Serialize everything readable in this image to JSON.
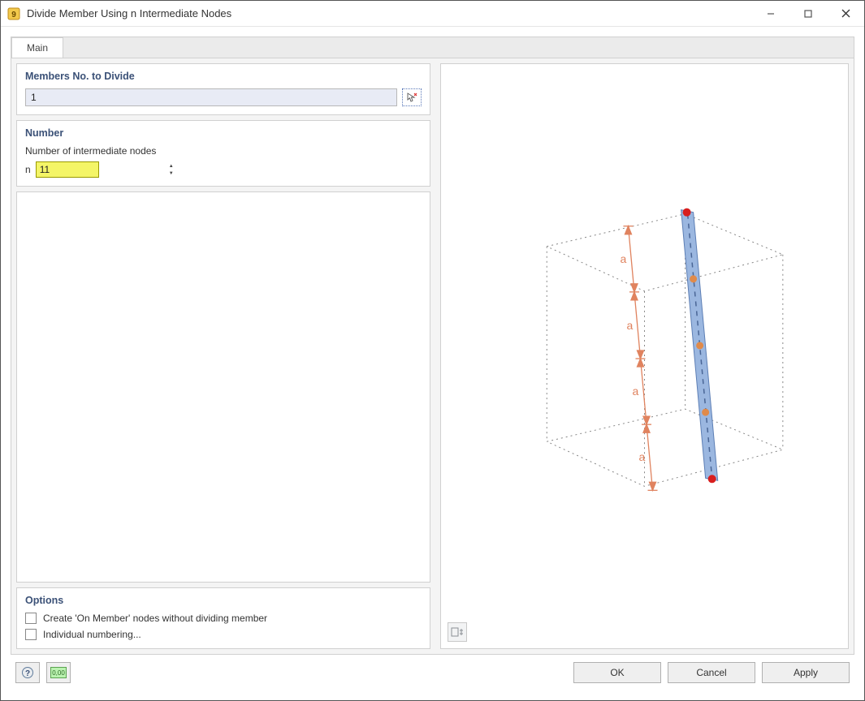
{
  "window": {
    "title": "Divide Member Using n Intermediate Nodes"
  },
  "tabs": {
    "main": "Main"
  },
  "members": {
    "heading": "Members No. to Divide",
    "value": "1"
  },
  "number": {
    "heading": "Number",
    "field_label": "Number of intermediate nodes",
    "prefix": "n",
    "value": "11"
  },
  "options": {
    "heading": "Options",
    "opt1": "Create 'On Member' nodes without dividing member",
    "opt2": "Individual numbering..."
  },
  "buttons": {
    "ok": "OK",
    "cancel": "Cancel",
    "apply": "Apply"
  },
  "preview": {
    "segment_label": "a"
  },
  "colors": {
    "heading": "#3b5177",
    "highlight_bg": "#f4f567",
    "member_fill": "#9bb7e0",
    "member_edge": "#5d7fb5",
    "dim": "#e0835f",
    "node_end": "#d81e1e",
    "node_mid": "#e08a4a"
  }
}
